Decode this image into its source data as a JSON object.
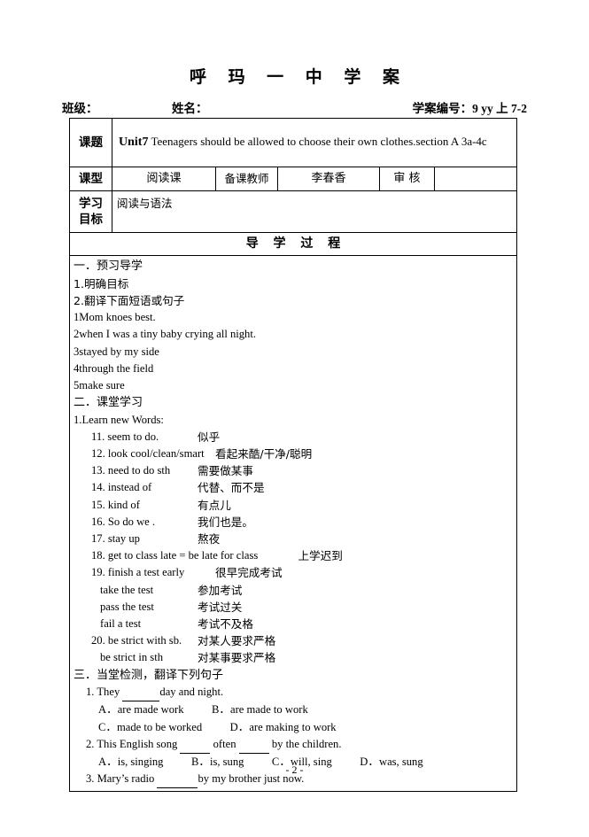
{
  "document": {
    "title": "呼 玛 一 中 学 案",
    "footer": "- 2 -"
  },
  "info": {
    "class_label": "班级：",
    "name_label": "姓名：",
    "number_label": "学案编号：",
    "number_value": "9 yy 上 7-2"
  },
  "table": {
    "topic": {
      "label": "课题",
      "unit": "Unit7",
      "text": " Teenagers should be allowed to choose their own clothes.section A 3a-4c"
    },
    "lesson_type": {
      "label": "课型",
      "value": "阅读课",
      "teacher_label": "备课教师",
      "teacher_value": "李春香",
      "review_label": "审  核",
      "review_value": ""
    },
    "objective": {
      "label": "学习目标",
      "label_line1": "学习",
      "label_line2": "目标",
      "value": "阅读与语法"
    },
    "process_header": "导  学  过  程"
  },
  "content": {
    "section1_title": "一．预习导学",
    "section1_lines": [
      "1.明确目标",
      "2.翻译下面短语或句子"
    ],
    "section1_items": [
      "1Mom knoes best.",
      "2when I was a tiny baby crying all night.",
      "3stayed by my side",
      "4through the field",
      "5make sure"
    ],
    "section2_title": "二．课堂学习",
    "section2_subtitle": "1.Learn new Words:",
    "vocab": [
      {
        "num": "11.",
        "en": "seem to do.",
        "cn": "似乎",
        "indent": 1
      },
      {
        "num": "12.",
        "en": "look cool/clean/smart",
        "cn": "看起来酷/干净/聪明",
        "indent": 1
      },
      {
        "num": "13.",
        "en": "need to do sth",
        "cn": "需要做某事",
        "indent": 1
      },
      {
        "num": "14.",
        "en": "instead of",
        "cn": "代替、而不是",
        "indent": 1
      },
      {
        "num": "15.",
        "en": "kind of",
        "cn": "有点儿",
        "indent": 1
      },
      {
        "num": "16.",
        "en": "So do we .",
        "cn": "我们也是。",
        "indent": 1
      },
      {
        "num": "17.",
        "en": "stay up",
        "cn": "熬夜",
        "indent": 1
      },
      {
        "num": "18.",
        "en": "get to class late = be late for class",
        "cn": "上学迟到",
        "indent": 1
      },
      {
        "num": "19.",
        "en": "finish a test early",
        "cn": "很早完成考试",
        "indent": 1
      },
      {
        "num": "",
        "en": "take the test",
        "cn": "参加考试",
        "indent": 2
      },
      {
        "num": "",
        "en": "pass the test",
        "cn": "考试过关",
        "indent": 2
      },
      {
        "num": "",
        "en": "fail a test",
        "cn": "考试不及格",
        "indent": 2
      },
      {
        "num": "20.",
        "en": "be strict with sb.",
        "cn": "对某人要求严格",
        "indent": 1
      },
      {
        "num": "",
        "en": "be strict in sth",
        "cn": "对某事要求严格",
        "indent": 2
      }
    ],
    "section3_title": "三．当堂检测，翻译下列句子",
    "questions": [
      {
        "stem_pre": "1. They ",
        "stem_post": "day and night.",
        "choices_line1": "A．are made work          B．are made to work",
        "choices_line2": "C．made to be worked          D．are making to work"
      },
      {
        "stem_pre": "2. This English song ",
        "stem_mid": " often ",
        "stem_post": " by the children.",
        "choices_line1": "A．is, singing          B．is, sung          C．will, sing          D．was, sung"
      },
      {
        "stem_pre": "3. Mary’s radio ",
        "stem_post": "by my brother just now."
      }
    ]
  }
}
